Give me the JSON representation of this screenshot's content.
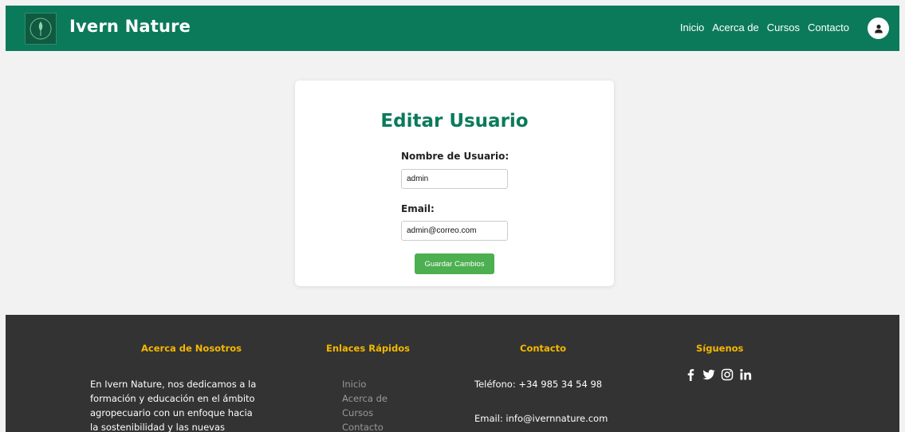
{
  "header": {
    "brand": "Ivern Nature",
    "nav": [
      "Inicio",
      "Acerca de",
      "Cursos",
      "Contacto"
    ]
  },
  "form": {
    "title": "Editar Usuario",
    "username_label": "Nombre de Usuario:",
    "username_value": "admin",
    "email_label": "Email:",
    "email_value": "admin@correo.com",
    "save_label": "Guardar Cambios"
  },
  "footer": {
    "about": {
      "heading": "Acerca de Nosotros",
      "lines": [
        "En Ivern Nature, nos dedicamos a la",
        "formación y educación en el ámbito",
        "agropecuario con un enfoque hacia",
        "la sostenibilidad y las nuevas"
      ]
    },
    "links": {
      "heading": "Enlaces Rápidos",
      "items": [
        "Inicio",
        "Acerca de",
        "Cursos",
        "Contacto"
      ]
    },
    "contact": {
      "heading": "Contacto",
      "phone": "Teléfono: +34 985 34 54 98",
      "email": "Email: info@ivernnature.com"
    },
    "social": {
      "heading": "Síguenos",
      "icons": [
        "facebook-icon",
        "twitter-icon",
        "instagram-icon",
        "linkedin-icon"
      ]
    }
  },
  "colors": {
    "brand_green": "#0b7a5a",
    "button_green": "#4caf50",
    "footer_bg": "#333333",
    "footer_heading": "#f5b800"
  }
}
